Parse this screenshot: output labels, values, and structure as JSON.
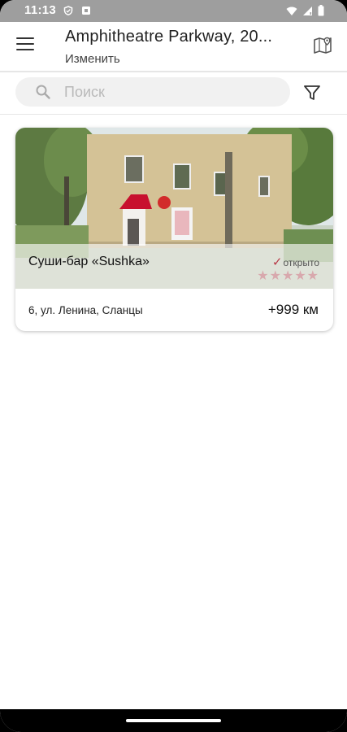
{
  "status_bar": {
    "time": "11:13",
    "icons": [
      "vpn-shield-icon",
      "notification-square-icon",
      "wifi-icon",
      "signal-icon",
      "battery-icon"
    ]
  },
  "app_bar": {
    "title": "Amphitheatre Parkway, 20...",
    "subtitle": "Изменить",
    "icons": [
      "menu-icon",
      "map-icon"
    ]
  },
  "search": {
    "placeholder": "Поиск",
    "icons": [
      "search-icon",
      "filter-icon"
    ]
  },
  "places": [
    {
      "name": "Суши-бар «Sushka»",
      "status": "открыто",
      "rating_stars": 5,
      "rating_filled": 0,
      "address": "6, ул. Ленина, Сланцы",
      "distance": "+999 км"
    }
  ],
  "colors": {
    "status_bar": "#9e9e9e",
    "accent_check": "#b83a48",
    "star_empty": "#d8a8ad",
    "search_bg": "#f1f1f1"
  }
}
